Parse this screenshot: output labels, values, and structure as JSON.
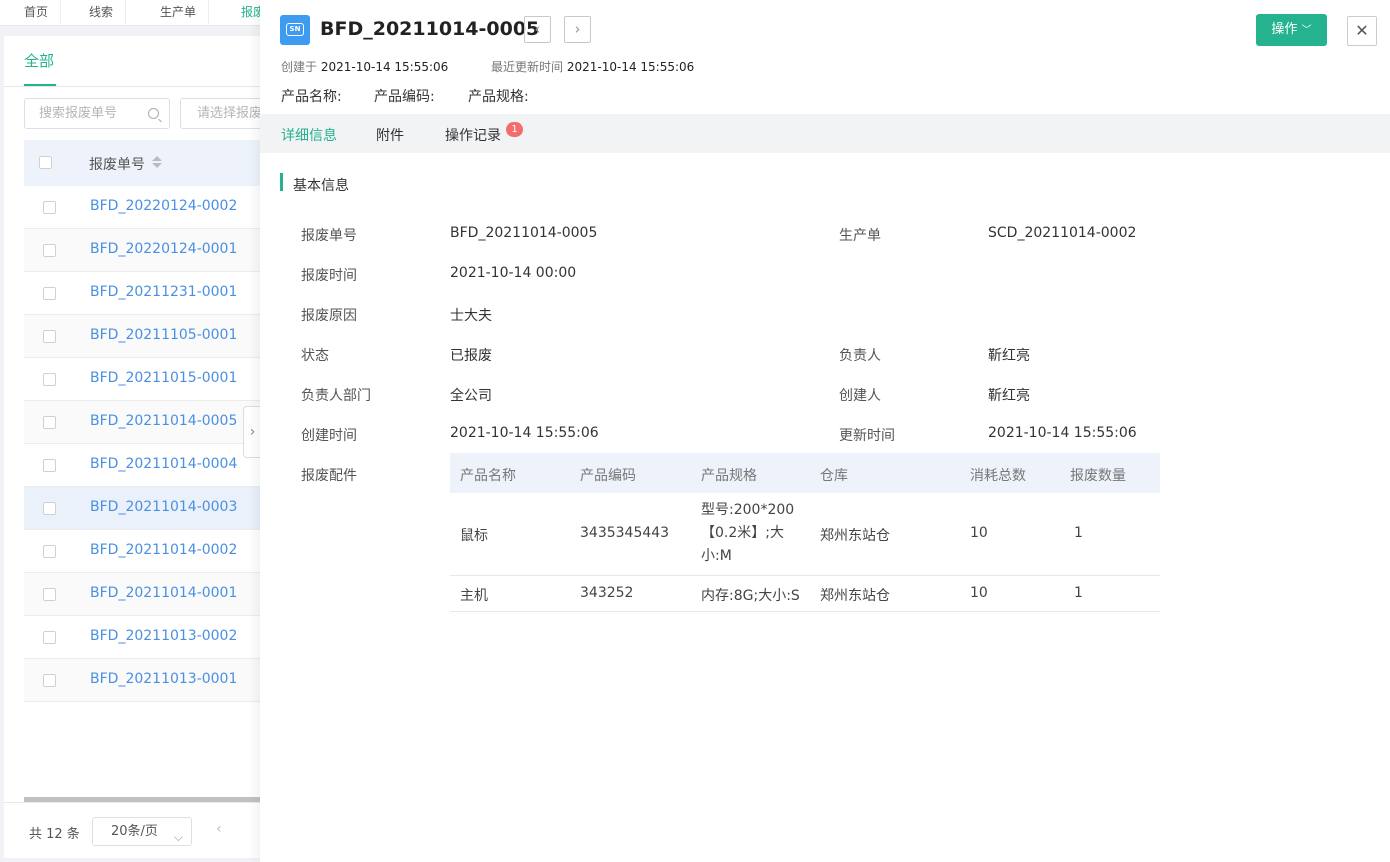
{
  "nav": {
    "tabs": [
      "首页",
      "线索",
      "生产单",
      "报废"
    ]
  },
  "list": {
    "tab_all": "全部",
    "search_placeholder": "搜索报废单号",
    "select_placeholder": "请选择报废",
    "column_header": "报废单号",
    "rows": [
      "BFD_20220124-0002",
      "BFD_20220124-0001",
      "BFD_20211231-0001",
      "BFD_20211105-0001",
      "BFD_20211015-0001",
      "BFD_20211014-0005",
      "BFD_20211014-0004",
      "BFD_20211014-0003",
      "BFD_20211014-0002",
      "BFD_20211014-0001",
      "BFD_20211013-0002",
      "BFD_20211013-0001"
    ],
    "selected_row": "BFD_20211014-0003",
    "total": "共 12 条",
    "page_size": "20条/页"
  },
  "detail": {
    "icon_text": "SN",
    "title": "BFD_20211014-0005",
    "operate_label": "操作",
    "created_label": "创建于",
    "created_value": "2021-10-14 15:55:06",
    "updated_label": "最近更新时间",
    "updated_value": "2021-10-14 15:55:06",
    "product_name_label": "产品名称:",
    "product_code_label": "产品编码:",
    "product_spec_label": "产品规格:",
    "tabs": [
      "详细信息",
      "附件",
      "操作记录"
    ],
    "record_badge": "1",
    "section_title": "基本信息",
    "fields": {
      "scrap_no_label": "报废单号",
      "scrap_no": "BFD_20211014-0005",
      "production_order_label": "生产单",
      "production_order": "SCD_20211014-0002",
      "scrap_time_label": "报废时间",
      "scrap_time": "2021-10-14 00:00",
      "reason_label": "报废原因",
      "reason": "士大夫",
      "status_label": "状态",
      "status": "已报废",
      "owner_label": "负责人",
      "owner": "靳红亮",
      "dept_label": "负责人部门",
      "dept": "全公司",
      "creator_label": "创建人",
      "creator": "靳红亮",
      "create_time_label": "创建时间",
      "create_time": "2021-10-14 15:55:06",
      "update_time_label": "更新时间",
      "update_time": "2021-10-14 15:55:06",
      "parts_label": "报废配件"
    },
    "parts_table": {
      "headers": [
        "产品名称",
        "产品编码",
        "产品规格",
        "仓库",
        "消耗总数",
        "报废数量"
      ],
      "rows": [
        [
          "鼠标",
          "3435345443",
          "型号:200*200【0.2米】;大小:M",
          "郑州东站仓",
          "10",
          "1"
        ],
        [
          "主机",
          "343252",
          "内存:8G;大小:S",
          "郑州东站仓",
          "10",
          "1"
        ]
      ]
    }
  },
  "colors": {
    "accent": "#25b28e",
    "link": "#4a90e2",
    "badge": "#f56c6c",
    "sn_icon": "#3d9bf0"
  }
}
